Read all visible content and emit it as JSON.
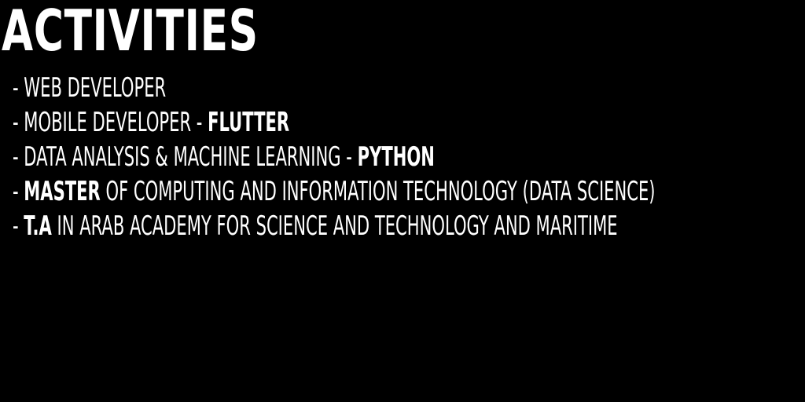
{
  "title": "ACTIVITIES",
  "items": [
    {
      "dash": "- ",
      "before": "WEB DEVELOPER",
      "bold": "",
      "after": ""
    },
    {
      "dash": "- ",
      "before": "MOBILE DEVELOPER - ",
      "bold": "FLUTTER",
      "after": ""
    },
    {
      "dash": "- ",
      "before": "DATA ANALYSIS & MACHINE LEARNING - ",
      "bold": "PYTHON",
      "after": ""
    },
    {
      "dash": "- ",
      "before": "",
      "bold": "MASTER",
      "after": " OF COMPUTING AND INFORMATION TECHNOLOGY (DATA SCIENCE)"
    },
    {
      "dash": "- ",
      "before": "",
      "bold": "T.A",
      "after": " IN ARAB ACADEMY FOR SCIENCE AND TECHNOLOGY AND MARITIME"
    }
  ]
}
